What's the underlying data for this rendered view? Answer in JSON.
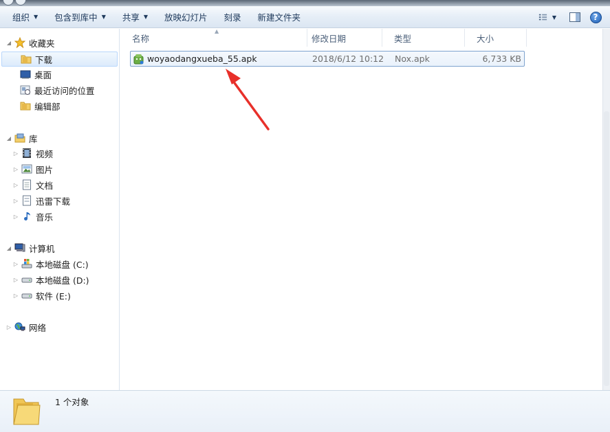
{
  "toolbar": {
    "organize": "组织",
    "include_in_library": "包含到库中",
    "share": "共享",
    "slideshow": "放映幻灯片",
    "burn": "刻录",
    "new_folder": "新建文件夹"
  },
  "nav": {
    "favorites": {
      "label": "收藏夹",
      "items": [
        {
          "label": "下载",
          "icon": "folder-icon"
        },
        {
          "label": "桌面",
          "icon": "desktop-icon"
        },
        {
          "label": "最近访问的位置",
          "icon": "recent-places-icon"
        },
        {
          "label": "编辑部",
          "icon": "folder-icon"
        }
      ]
    },
    "libraries": {
      "label": "库",
      "items": [
        {
          "label": "视频",
          "icon": "video-icon"
        },
        {
          "label": "图片",
          "icon": "pictures-icon"
        },
        {
          "label": "文档",
          "icon": "documents-icon"
        },
        {
          "label": "迅雷下载",
          "icon": "download-library-icon"
        },
        {
          "label": "音乐",
          "icon": "music-icon"
        }
      ]
    },
    "computer": {
      "label": "计算机",
      "items": [
        {
          "label": "本地磁盘 (C:)",
          "icon": "system-drive-icon"
        },
        {
          "label": "本地磁盘 (D:)",
          "icon": "drive-icon"
        },
        {
          "label": "软件 (E:)",
          "icon": "drive-icon"
        }
      ]
    },
    "network": {
      "label": "网络"
    }
  },
  "columns": {
    "name": "名称",
    "modified": "修改日期",
    "type": "类型",
    "size": "大小"
  },
  "files": [
    {
      "name": "woyaodangxueba_55.apk",
      "modified": "2018/6/12 10:12",
      "type": "Nox.apk",
      "size": "6,733 KB"
    }
  ],
  "status": {
    "count_text": "1 个对象"
  },
  "colors": {
    "toolbar_text": "#1e395b",
    "selection_border": "#7da2ce",
    "annotation_arrow": "#e8302a"
  }
}
